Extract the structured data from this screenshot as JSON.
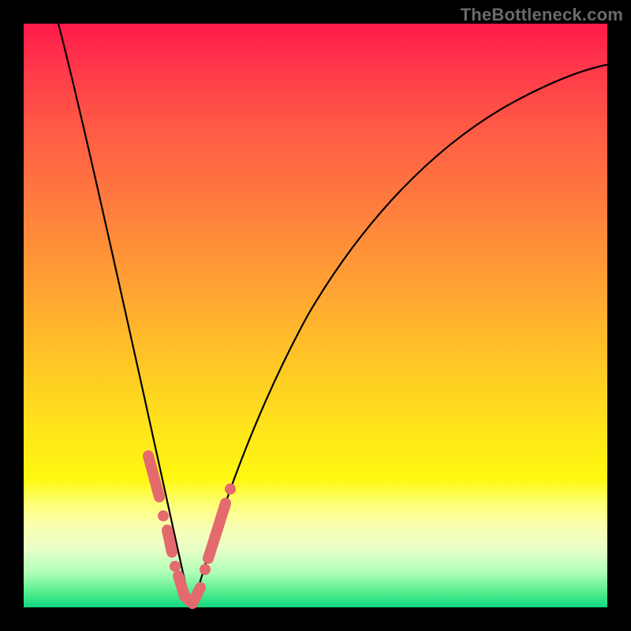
{
  "watermark": "TheBottleneck.com",
  "chart_data": {
    "type": "line",
    "title": "",
    "xlabel": "",
    "ylabel": "",
    "xlim": [
      0,
      100
    ],
    "ylim": [
      0,
      100
    ],
    "grid": false,
    "series": [
      {
        "name": "bottleneck-curve",
        "x": [
          6,
          8,
          10,
          12.5,
          15,
          17.5,
          20,
          22,
          24,
          26,
          27,
          28.5,
          30,
          33,
          36,
          40,
          45,
          50,
          55,
          60,
          65,
          70,
          75,
          80,
          85,
          90,
          95,
          100
        ],
        "y": [
          100,
          92,
          82,
          70,
          57,
          44,
          31,
          22,
          14,
          7,
          3,
          0,
          3,
          10,
          18,
          28,
          39,
          48,
          56,
          63,
          69,
          74,
          78,
          82,
          85,
          87.5,
          89.5,
          91
        ]
      }
    ],
    "highlights": {
      "name": "highlighted-points",
      "x": [
        21.5,
        22.8,
        23.8,
        25.2,
        26.2,
        27.2,
        28.1,
        29.6,
        31.2,
        32.6,
        33.5,
        34.3,
        35.2
      ],
      "y": [
        26,
        20,
        14.5,
        8.5,
        4.8,
        2,
        0.2,
        1.5,
        6,
        10,
        13.5,
        16,
        19
      ]
    },
    "gradient_stops": [
      {
        "pos": 0,
        "color": "#ff1a4a"
      },
      {
        "pos": 30,
        "color": "#ff7a3f"
      },
      {
        "pos": 58,
        "color": "#ffc626"
      },
      {
        "pos": 82,
        "color": "#fdff70"
      },
      {
        "pos": 100,
        "color": "#10d880"
      }
    ]
  }
}
